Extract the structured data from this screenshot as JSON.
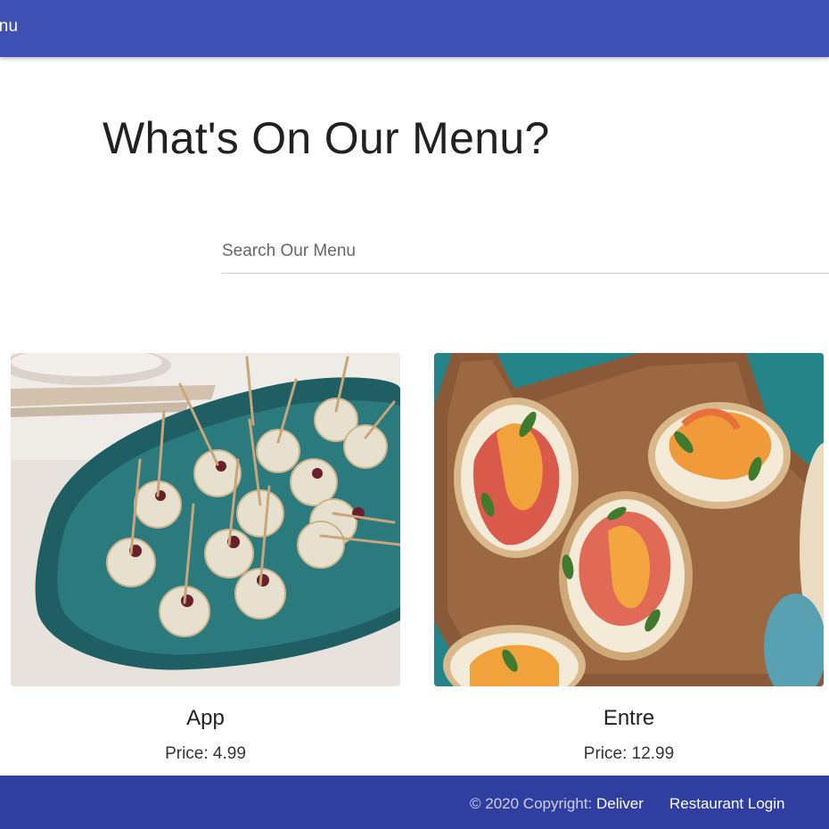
{
  "nav": {
    "title": "enu"
  },
  "page": {
    "title": "What's On Our Menu?"
  },
  "search": {
    "placeholder": "Search Our Menu",
    "value": ""
  },
  "menu_items": [
    {
      "name": "App",
      "price_text": "Price: 4.99",
      "image": "appetizer-bites-photo"
    },
    {
      "name": "Entre",
      "price_text": "Price: 12.99",
      "image": "bruschetta-photo"
    }
  ],
  "footer": {
    "copyright_prefix": "© 2020 Copyright: ",
    "brand": "Deliver",
    "login_label": "Restaurant Login"
  },
  "colors": {
    "primary": "#3f51b5",
    "footer": "#303f9f",
    "text": "#212121"
  }
}
